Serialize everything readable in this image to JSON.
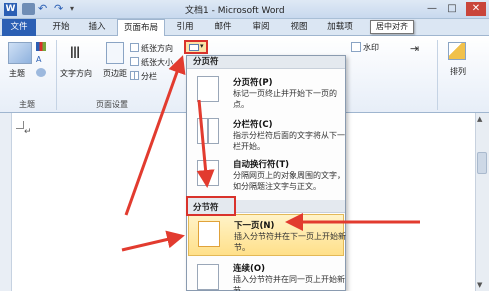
{
  "window": {
    "title": "文档1 - Microsoft Word",
    "app_icon": "W"
  },
  "tabs": [
    {
      "label": "文件"
    },
    {
      "label": "开始"
    },
    {
      "label": "插入"
    },
    {
      "label": "页面布局"
    },
    {
      "label": "引用"
    },
    {
      "label": "邮件"
    },
    {
      "label": "审阅"
    },
    {
      "label": "视图"
    },
    {
      "label": "加载项"
    }
  ],
  "tooltip": "居中对齐",
  "ribbon": {
    "theme_group": {
      "theme_label": "主题",
      "group_label": "主题"
    },
    "page_setup": {
      "text_direction": "文字方向",
      "margins": "页边距",
      "orientation": "纸张方向",
      "size": "纸张大小",
      "columns": "分栏",
      "group_label": "页面设置"
    },
    "watermark": "水印",
    "arrange": "排列"
  },
  "breaks_menu": {
    "page_breaks_header": "分页符",
    "section_breaks_header": "分节符",
    "items": [
      {
        "title": "分页符(P)",
        "desc": "标记一页终止并开始下一页的点。"
      },
      {
        "title": "分栏符(C)",
        "desc": "指示分栏符后面的文字将从下一栏开始。"
      },
      {
        "title": "自动换行符(T)",
        "desc": "分隔网页上的对象周围的文字，如分隔题注文字与正文。"
      },
      {
        "title": "下一页(N)",
        "desc": "插入分节符并在下一页上开始新节。"
      },
      {
        "title": "连续(O)",
        "desc": "插入分节符并在同一页上开始新节。"
      }
    ]
  },
  "document": {
    "paragraph_mark": "↵"
  },
  "colors": {
    "accent_blue": "#2b5fb4",
    "annotation_red": "#e23b2f",
    "highlight": "#ffe08a"
  }
}
